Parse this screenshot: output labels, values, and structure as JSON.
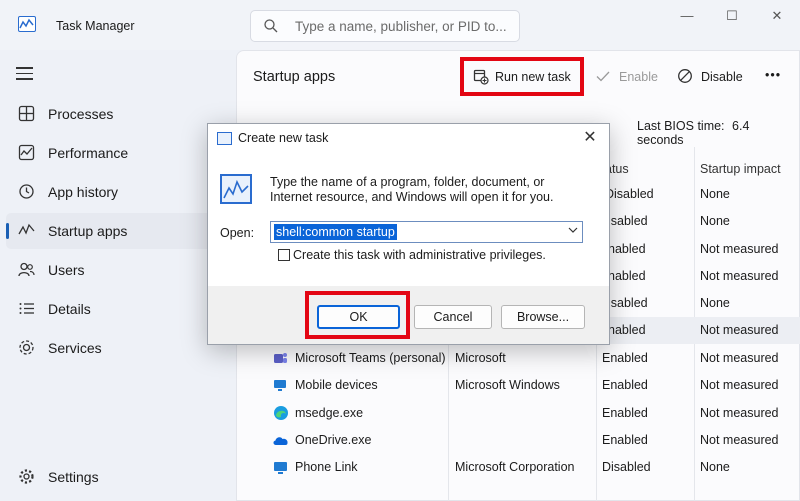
{
  "app": {
    "title": "Task Manager",
    "search_placeholder": "Type a name, publisher, or PID to..."
  },
  "window_controls": {
    "minimize": "—",
    "maximize": "☐",
    "close": "✕"
  },
  "sidebar": {
    "items": [
      {
        "label": "Processes",
        "icon": "processes-icon",
        "active": false
      },
      {
        "label": "Performance",
        "icon": "performance-icon",
        "active": false
      },
      {
        "label": "App history",
        "icon": "history-icon",
        "active": false
      },
      {
        "label": "Startup apps",
        "icon": "startup-icon",
        "active": true
      },
      {
        "label": "Users",
        "icon": "users-icon",
        "active": false
      },
      {
        "label": "Details",
        "icon": "details-icon",
        "active": false
      },
      {
        "label": "Services",
        "icon": "services-icon",
        "active": false
      }
    ],
    "settings_label": "Settings"
  },
  "toolbar": {
    "page_title": "Startup apps",
    "run_new_task": "Run new task",
    "enable": "Enable",
    "disable": "Disable",
    "more": "•••"
  },
  "bios": {
    "label": "Last BIOS time:",
    "value": "6.4 seconds"
  },
  "table": {
    "columns": [
      "atus",
      "Startup impact"
    ],
    "partial_rows": [
      {
        "status": "Disabled",
        "impact": "None"
      },
      {
        "status": "isabled",
        "impact": "None"
      },
      {
        "status": "nabled",
        "impact": "Not measured"
      },
      {
        "status": "nabled",
        "impact": "Not measured"
      },
      {
        "status": "isabled",
        "impact": "None"
      },
      {
        "status": "nabled",
        "impact": "Not measured"
      }
    ],
    "rows": [
      {
        "name": "Microsoft Teams (personal)",
        "publisher": "Microsoft",
        "status": "Enabled",
        "impact": "Not measured",
        "icon": "teams-icon"
      },
      {
        "name": "Mobile devices",
        "publisher": "Microsoft Windows",
        "status": "Enabled",
        "impact": "Not measured",
        "icon": "mobile-devices-icon"
      },
      {
        "name": "msedge.exe",
        "publisher": "",
        "status": "Enabled",
        "impact": "Not measured",
        "icon": "edge-icon"
      },
      {
        "name": "OneDrive.exe",
        "publisher": "",
        "status": "Enabled",
        "impact": "Not measured",
        "icon": "onedrive-icon"
      },
      {
        "name": "Phone Link",
        "publisher": "Microsoft Corporation",
        "status": "Disabled",
        "impact": "None",
        "icon": "phone-link-icon"
      }
    ]
  },
  "dialog": {
    "title": "Create new task",
    "close": "✕",
    "message": "Type the name of a program, folder, document, or Internet resource, and Windows will open it for you.",
    "open_label": "Open:",
    "open_value": "shell:common startup",
    "checkbox_label": "Create this task with administrative privileges.",
    "ok": "OK",
    "cancel": "Cancel",
    "browse": "Browse..."
  },
  "colors": {
    "highlight": "#e30613",
    "accent": "#0a64d8"
  }
}
